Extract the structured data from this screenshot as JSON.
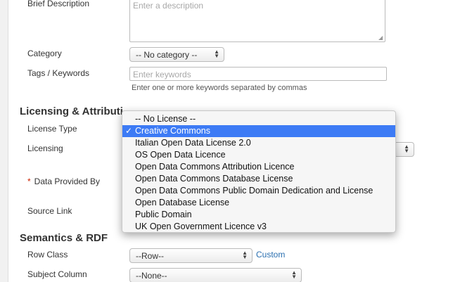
{
  "form": {
    "brief_description_label": "Brief Description",
    "brief_description_placeholder": "Enter a description",
    "category_label": "Category",
    "category_value": "-- No category --",
    "tags_label": "Tags / Keywords",
    "tags_placeholder": "Enter keywords",
    "tags_hint": "Enter one or more keywords separated by commas"
  },
  "licensing": {
    "section_title": "Licensing & Attributi",
    "license_type_label": "License Type",
    "licensing_label": "Licensing",
    "data_provided_by_label": "Data Provided By",
    "source_link_label": "Source Link"
  },
  "license_dropdown": {
    "options": [
      "-- No License --",
      "Creative Commons",
      "Italian Open Data License 2.0",
      "OS Open Data Licence",
      "Open Data Commons Attribution Licence",
      "Open Data Commons Database License",
      "Open Data Commons Public Domain Dedication and License",
      "Open Database License",
      "Public Domain",
      "UK Open Government Licence v3"
    ],
    "selected": "Creative Commons",
    "selected_color": "#3d7bf5"
  },
  "semantics": {
    "section_title": "Semantics & RDF",
    "row_class_label": "Row Class",
    "row_class_value": "--Row--",
    "custom_link": "Custom",
    "subject_column_label": "Subject Column",
    "subject_column_value": "--None--"
  },
  "colors": {
    "link": "#2a6fb0",
    "required": "#cc2200"
  }
}
